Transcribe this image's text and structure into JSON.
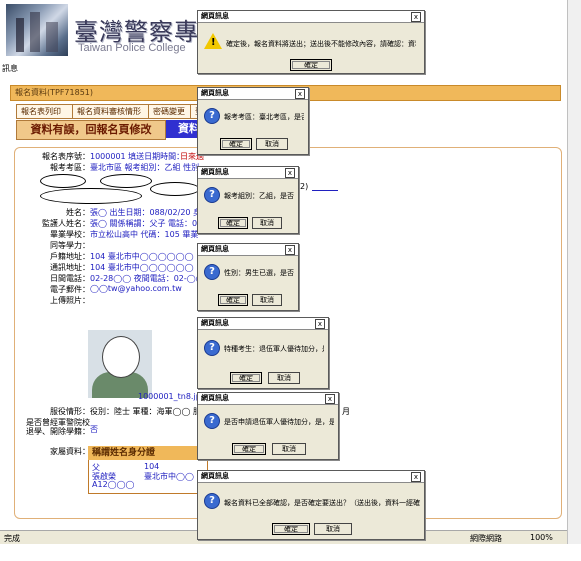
{
  "banner": {
    "title": "臺灣警察專科學校 網",
    "subtitle": "Taiwan Police College"
  },
  "menu_label": "訊息",
  "section_bar": "報名資料(TPF71851)",
  "tabs_row1": [
    "報名表列印",
    "報名資料審核情形",
    "密碼變更",
    "登"
  ],
  "tab_active": "資料有誤，回報名頁修改",
  "tab_blue": "資料",
  "form": {
    "rows": [
      {
        "label": "報名表序號：",
        "value": "1000001  填送日期時間：",
        "extra": "日來過"
      },
      {
        "label": "報考考區：",
        "value": "臺北市區  報考組別：乙組 性別：",
        "extra": ""
      },
      {
        "label": "姓名：",
        "value": "張◯  出生日期：088/02/20 身分",
        "extra": ""
      },
      {
        "label": "監護人姓名：",
        "value": "張◯  關係稱謂：父子 電話：02-",
        "extra": ""
      },
      {
        "label": "畢業學校：",
        "value": "市立松山高中 代碼：105 畢業年月",
        "extra": ""
      },
      {
        "label": "同等學力：",
        "value": "",
        "extra": ""
      },
      {
        "label": "戶籍地址：",
        "value": "104 臺北市中◯◯◯◯◯◯",
        "extra": ""
      },
      {
        "label": "通訊地址：",
        "value": "104 臺北市中◯◯◯◯◯◯",
        "extra": ""
      },
      {
        "label": "日間電話：",
        "value": "02-28◯◯ 夜間電話：02-◯◯",
        "extra": ""
      },
      {
        "label": "電子郵件：",
        "value": "◯◯tw@yahoo.com.tw",
        "extra": ""
      },
      {
        "label": "上傳照片：",
        "value": "",
        "extra": ""
      }
    ],
    "photo_filename": "1000001_tn8.jpg",
    "service_row": {
      "label": "服役情形：",
      "value": "役別：陸士  軍種：海軍◯◯ 服"
    },
    "reenlist_row": {
      "label": "是否曾經軍警院校\n退學、開除學籍：",
      "value": "否"
    },
    "family_label": "家屬資料：",
    "family_header": "稱謂姓名身分證",
    "family_cells": [
      "父",
      "張啟榮",
      "A12◯◯◯",
      "104",
      "臺北市中◯◯"
    ],
    "right_month": "月",
    "right_suffix": "2)"
  },
  "status_bar": {
    "left": "完成",
    "zone": "網際網路",
    "zoom": "100%"
  },
  "dialogs": [
    {
      "title": "網頁訊息",
      "icon": "warning-icon",
      "message": "確定後，報名資料將送出；送出後不能修改內容，請確認：資料一經確認後即不能修改",
      "buttons": [
        "確定"
      ]
    },
    {
      "title": "網頁訊息",
      "icon": "question-icon",
      "message": "報考考區：臺北考區，是否正確？",
      "buttons": [
        "確定",
        "取消"
      ]
    },
    {
      "title": "網頁訊息",
      "icon": "question-icon",
      "message": "報考組別：乙組，是否正確？",
      "buttons": [
        "確定",
        "取消"
      ]
    },
    {
      "title": "網頁訊息",
      "icon": "question-icon",
      "message": "性別：男生已選，是否正確？",
      "buttons": [
        "確定",
        "取消"
      ]
    },
    {
      "title": "網頁訊息",
      "icon": "question-icon",
      "message": "特種考生：退伍軍人優待加分，是否正確？",
      "buttons": [
        "確定",
        "取消"
      ]
    },
    {
      "title": "網頁訊息",
      "icon": "question-icon",
      "message": "是否申請退伍軍人優待加分，是，是否正確？",
      "buttons": [
        "確定",
        "取消"
      ]
    },
    {
      "title": "網頁訊息",
      "icon": "question-icon",
      "message": "報名資料已全部確認，是否確定要送出？（送出後，資料一經確認將無法修改）",
      "buttons": [
        "確定",
        "取消"
      ]
    }
  ],
  "colors": {
    "accent_orange": "#f0b85a",
    "tab_blue": "#3030d0",
    "link_blue": "#2020c0"
  }
}
